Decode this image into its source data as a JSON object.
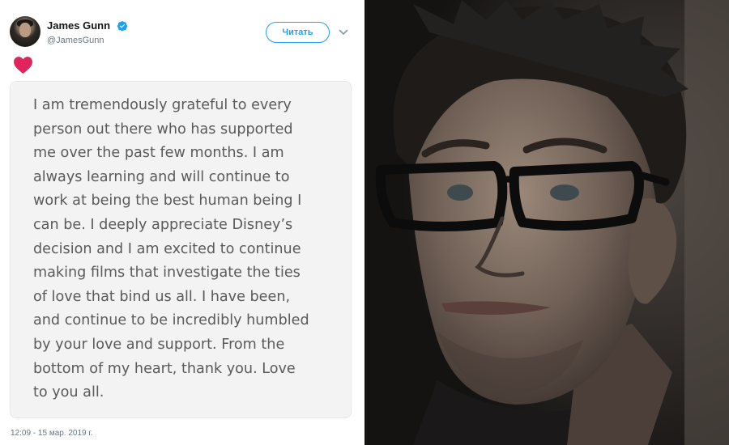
{
  "tweet": {
    "author": {
      "display_name": "James Gunn",
      "handle": "@JamesGunn",
      "verified": true
    },
    "follow_label": "Читать",
    "reaction": "heart-icon",
    "note_text": "I am tremendously grateful to every\nperson out there who has supported\nme over the past few months. I am\nalways learning and will continue to\nwork at being the best human being I\ncan be. I deeply appreciate Disney’s\ndecision and I am excited to continue\nmaking films that investigate the ties\nof love that bind us all. I have been,\nand continue to be incredibly humbled\nby your love and support. From the\nbottom of my heart, thank you. Love\nto you all.",
    "timestamp": "12:09 - 15 мар. 2019 г."
  },
  "colors": {
    "accent": "#1da1f2",
    "heart": "#e0245e",
    "note_background": "#f3f3f3",
    "note_text": "#5a5a5a"
  }
}
